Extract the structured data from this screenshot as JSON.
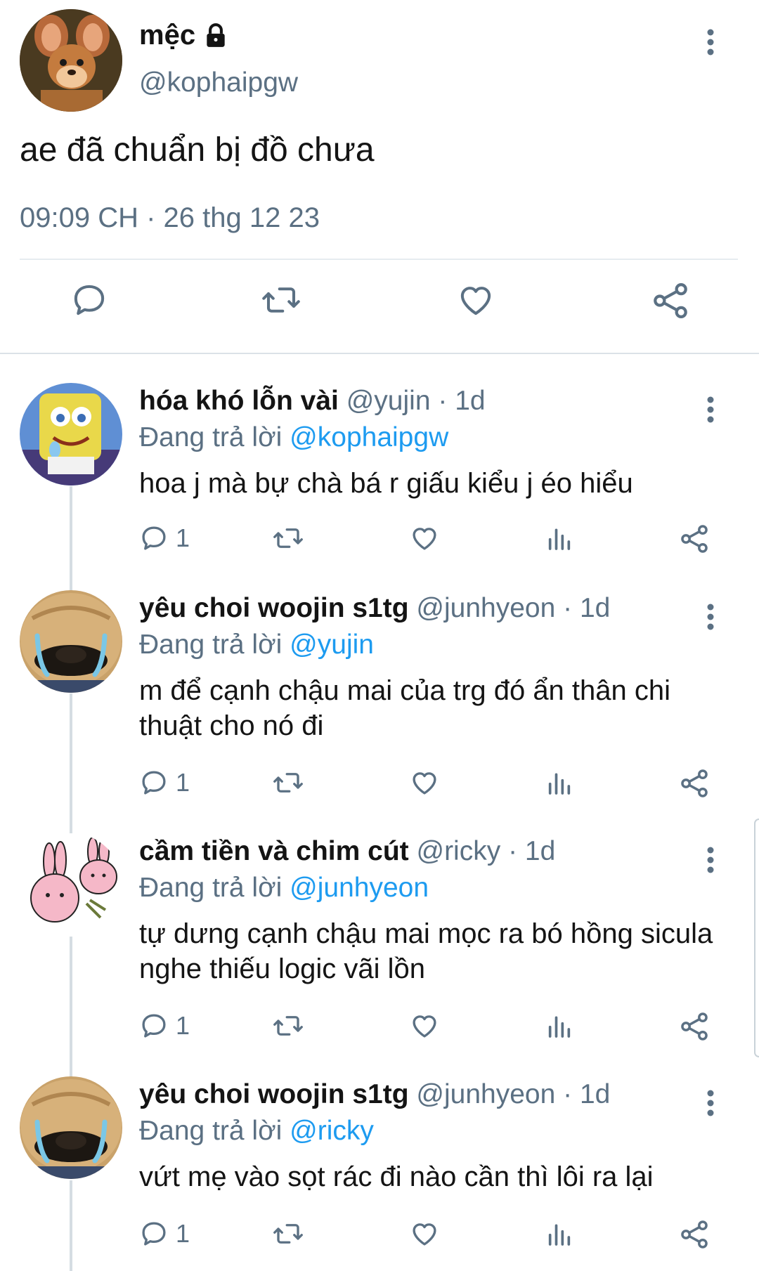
{
  "main_tweet": {
    "name": "mệc",
    "handle": "@kophaipgw",
    "text": "ae đã chuẩn bị đồ chưa",
    "timestamp": "09:09 CH · 26 thg 12 23",
    "avatar": "jerry-mouse-avatar",
    "locked_icon": "lock-icon"
  },
  "replies": [
    {
      "name": "hóa khó lỗn vài",
      "handle": "@yujin",
      "time": "· 1d",
      "replying_prefix": "Đang trả lời ",
      "replying_to": "@kophaipgw",
      "text": "hoa j mà bự chà bá r giấu kiểu j éo hiểu",
      "reply_count": "1",
      "avatar": "spongebob-avatar"
    },
    {
      "name": "yêu choi woojin s1tg",
      "handle": "@junhyeon",
      "time": "· 1d",
      "replying_prefix": "Đang trả lời ",
      "replying_to": "@yujin",
      "text": "m để cạnh chậu mai của trg đó ẩn thân chi thuật cho nó đi",
      "reply_count": "1",
      "avatar": "crying-dog-avatar"
    },
    {
      "name": "cầm tiền và chim cút",
      "handle": "@ricky",
      "time": "· 1d",
      "replying_prefix": "Đang trả lời ",
      "replying_to": "@junhyeon",
      "text": "tự dưng cạnh chậu mai mọc ra bó hồng sicula nghe thiếu logic vãi lồn",
      "reply_count": "1",
      "avatar": "pink-bunny-avatar"
    },
    {
      "name": "yêu choi woojin s1tg",
      "handle": "@junhyeon",
      "time": "· 1d",
      "replying_prefix": "Đang trả lời ",
      "replying_to": "@ricky",
      "text": "vứt mẹ vào sọt rác đi nào cần thì lôi ra lại",
      "reply_count": "1",
      "avatar": "crying-dog-avatar"
    }
  ],
  "colors": {
    "text": "#141414",
    "secondary": "#5b7083",
    "mention": "#1d9bf0",
    "divider": "#e6ecf0"
  }
}
